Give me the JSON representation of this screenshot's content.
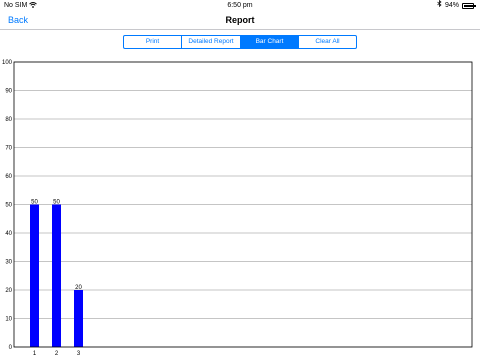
{
  "status_bar": {
    "carrier": "No SIM",
    "wifi_icon": "wifi-icon",
    "time": "6:50 pm",
    "bluetooth_icon": "bluetooth-icon",
    "battery_percent": "94%",
    "battery_level": 0.94
  },
  "nav": {
    "back_label": "Back",
    "title": "Report"
  },
  "segments": [
    {
      "label": "Print",
      "selected": false
    },
    {
      "label": "Detailed Report",
      "selected": false
    },
    {
      "label": "Bar Chart",
      "selected": true
    },
    {
      "label": "Clear All",
      "selected": false
    }
  ],
  "chart_data": {
    "type": "bar",
    "categories": [
      "1",
      "2",
      "3"
    ],
    "values": [
      50,
      50,
      20
    ],
    "data_labels": [
      "50",
      "50",
      "20"
    ],
    "ylim": [
      0,
      100
    ],
    "y_ticks": [
      0,
      10,
      20,
      30,
      40,
      50,
      60,
      70,
      80,
      90,
      100
    ],
    "grid": true,
    "bar_color": "#0000ff"
  }
}
